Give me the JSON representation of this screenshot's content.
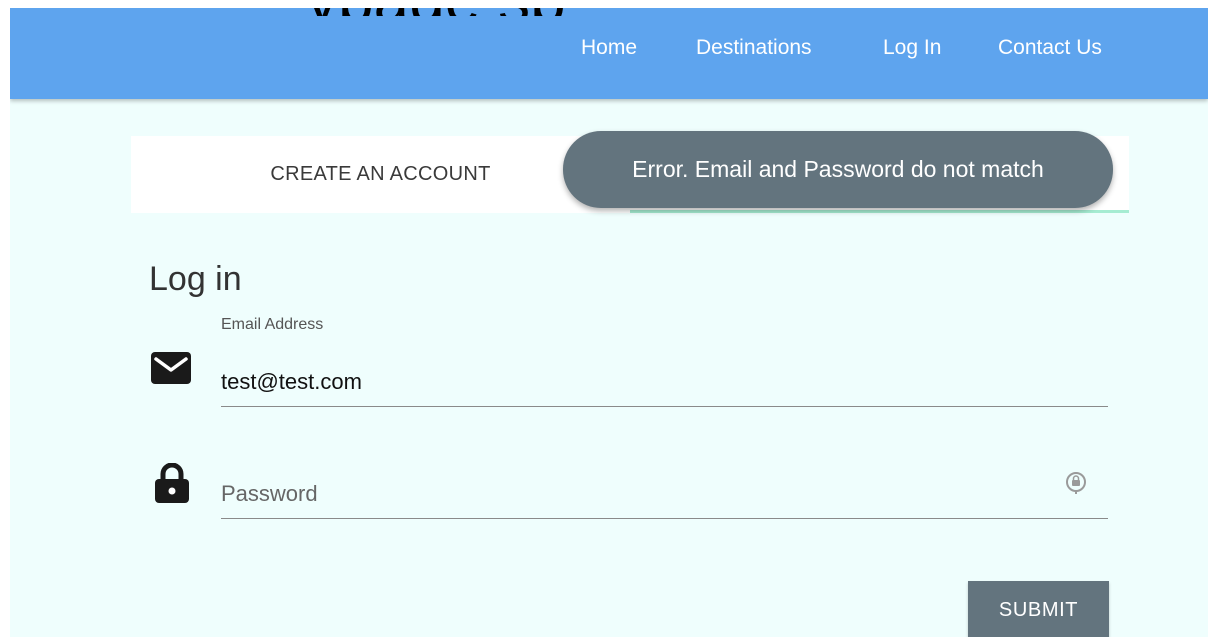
{
  "nav": {
    "items": [
      {
        "label": "Home"
      },
      {
        "label": "Destinations"
      },
      {
        "label": "Log In"
      },
      {
        "label": "Contact Us"
      }
    ]
  },
  "top_cut_text": "ypage sp",
  "tabs": {
    "create_label": "CREATE AN ACCOUNT"
  },
  "toast": {
    "message": "Error. Email and Password do not match"
  },
  "form": {
    "heading": "Log in",
    "email": {
      "label": "Email Address",
      "value": "test@test.com",
      "icon": "mail-icon"
    },
    "password": {
      "placeholder": "Password",
      "value": "",
      "icon": "lock-icon",
      "autofill_icon": "password-key-icon"
    },
    "submit_label": "SUBMIT"
  },
  "colors": {
    "navbar": "#5ea4ee",
    "page_background": "#effefd",
    "toast": "#63747e",
    "submit": "#63747e",
    "tab_indicator": "#a6ecd2"
  }
}
